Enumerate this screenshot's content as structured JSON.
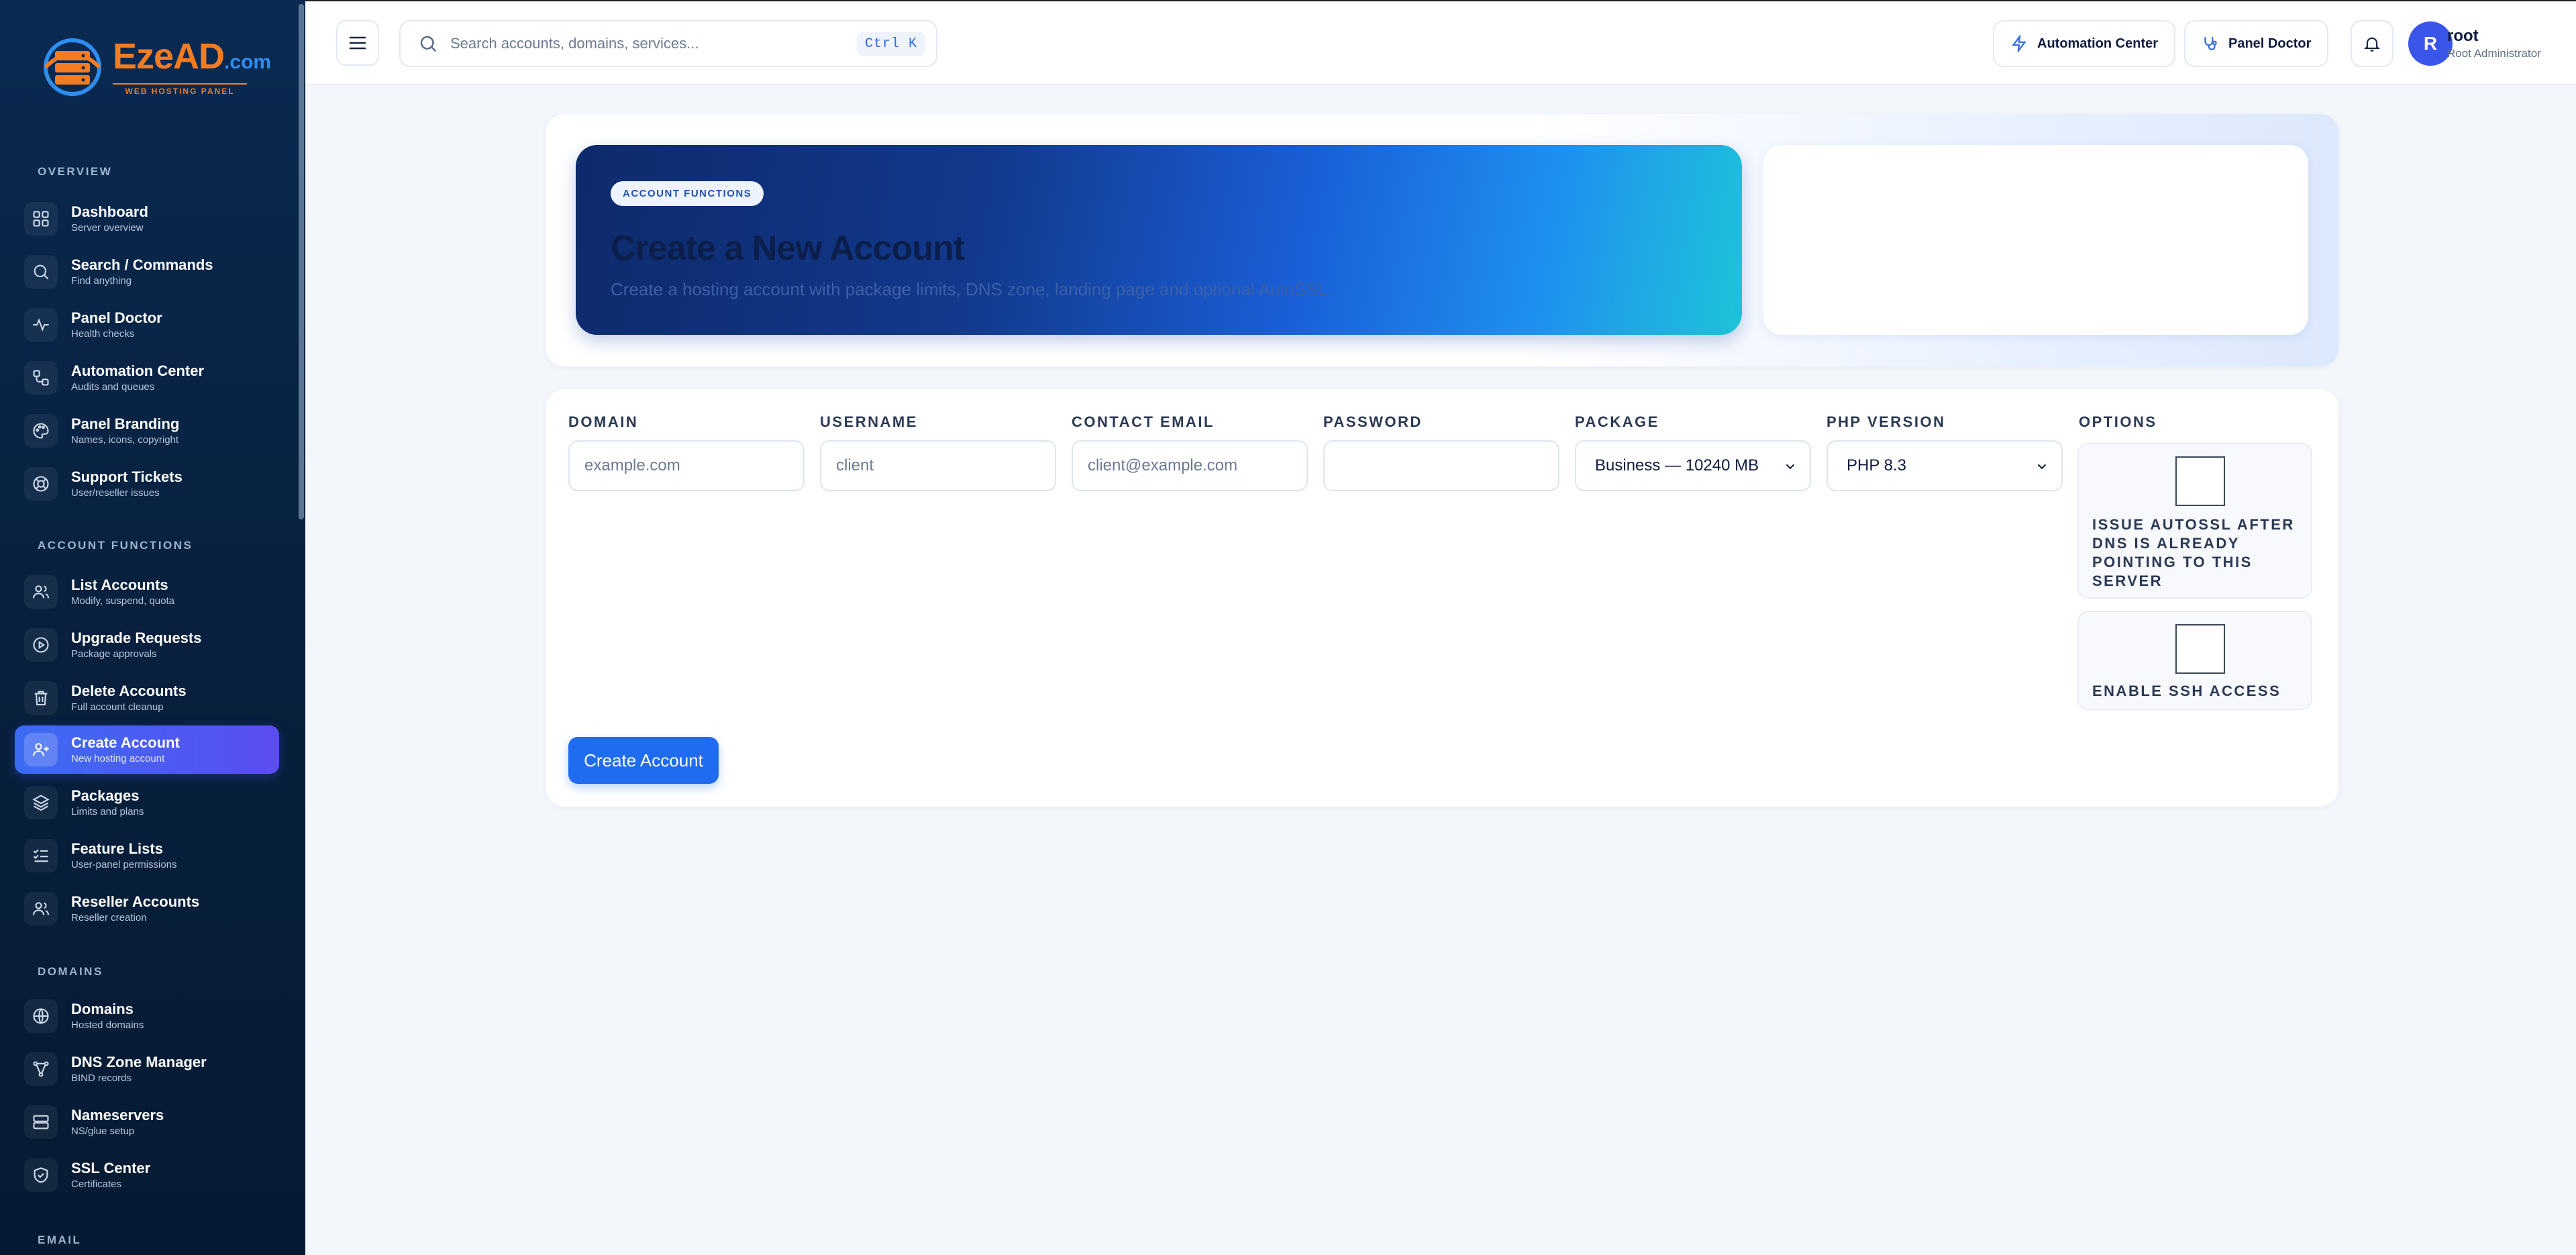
{
  "brand": {
    "name": "EzeAD",
    "domain_suffix": ".com",
    "tagline": "WEB HOSTING PANEL"
  },
  "sidebar": {
    "sections": [
      {
        "title": "OVERVIEW"
      },
      {
        "title": "ACCOUNT FUNCTIONS"
      },
      {
        "title": "DOMAINS"
      },
      {
        "title": "EMAIL"
      }
    ],
    "items": [
      {
        "label": "Dashboard",
        "sub": "Server overview",
        "icon": "grid-icon"
      },
      {
        "label": "Search / Commands",
        "sub": "Find anything",
        "icon": "search-icon"
      },
      {
        "label": "Panel Doctor",
        "sub": "Health checks",
        "icon": "pulse-icon"
      },
      {
        "label": "Automation Center",
        "sub": "Audits and queues",
        "icon": "workflow-icon"
      },
      {
        "label": "Panel Branding",
        "sub": "Names, icons, copyright",
        "icon": "palette-icon"
      },
      {
        "label": "Support Tickets",
        "sub": "User/reseller issues",
        "icon": "lifebuoy-icon"
      },
      {
        "label": "List Accounts",
        "sub": "Modify, suspend, quota",
        "icon": "users-icon"
      },
      {
        "label": "Upgrade Requests",
        "sub": "Package approvals",
        "icon": "play-circle-icon"
      },
      {
        "label": "Delete Accounts",
        "sub": "Full account cleanup",
        "icon": "trash-icon"
      },
      {
        "label": "Create Account",
        "sub": "New hosting account",
        "icon": "user-plus-icon",
        "active": true
      },
      {
        "label": "Packages",
        "sub": "Limits and plans",
        "icon": "layers-icon"
      },
      {
        "label": "Feature Lists",
        "sub": "User-panel permissions",
        "icon": "list-check-icon"
      },
      {
        "label": "Reseller Accounts",
        "sub": "Reseller creation",
        "icon": "users-icon"
      },
      {
        "label": "Domains",
        "sub": "Hosted domains",
        "icon": "globe-icon"
      },
      {
        "label": "DNS Zone Manager",
        "sub": "BIND records",
        "icon": "network-icon"
      },
      {
        "label": "Nameservers",
        "sub": "NS/glue setup",
        "icon": "server-icon"
      },
      {
        "label": "SSL Center",
        "sub": "Certificates",
        "icon": "shield-check-icon"
      }
    ]
  },
  "topbar": {
    "search_placeholder": "Search accounts, domains, services...",
    "shortcut": "Ctrl K",
    "automation_label": "Automation Center",
    "doctor_label": "Panel Doctor",
    "user_initial": "R",
    "user_name": "root",
    "user_role": "Root Administrator"
  },
  "hero": {
    "chip": "ACCOUNT FUNCTIONS",
    "title": "Create a New Account",
    "description": "Create a hosting account with package limits, DNS zone, landing page and optional AutoSSL."
  },
  "form": {
    "domain_label": "DOMAIN",
    "domain_placeholder": "example.com",
    "username_label": "USERNAME",
    "username_placeholder": "client",
    "email_label": "CONTACT EMAIL",
    "email_placeholder": "client@example.com",
    "password_label": "PASSWORD",
    "password_value": "",
    "package_label": "PACKAGE",
    "package_value": "Business — 10240 MB",
    "php_label": "PHP VERSION",
    "php_value": "PHP 8.3",
    "options_label": "OPTIONS",
    "option_autossl": "ISSUE AUTOSSL AFTER DNS IS ALREADY POINTING TO THIS SERVER",
    "option_ssh": "ENABLE SSH ACCESS",
    "submit_label": "Create Account"
  }
}
